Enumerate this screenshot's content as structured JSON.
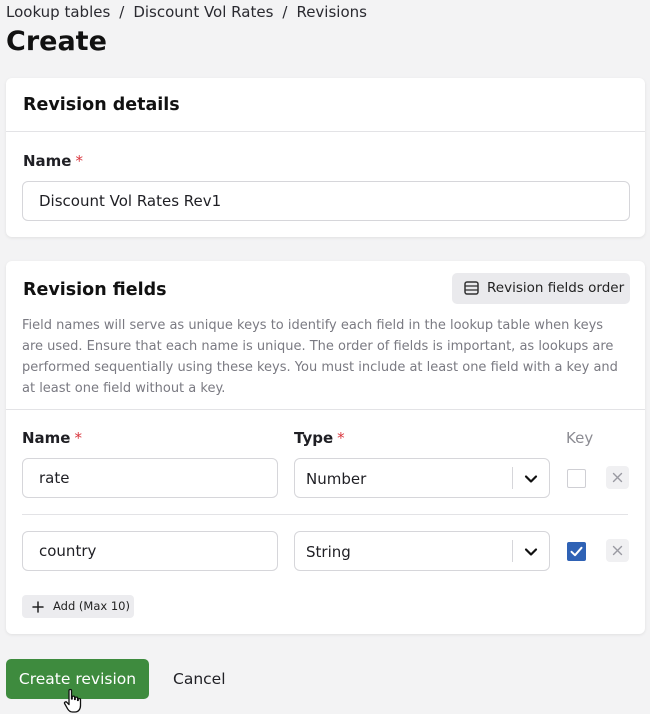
{
  "breadcrumb": [
    "Lookup tables",
    "Discount Vol Rates",
    "Revisions"
  ],
  "page_title": "Create",
  "details": {
    "title": "Revision details",
    "name_label": "Name",
    "required_mark": "*",
    "name_value": "Discount Vol Rates Rev1"
  },
  "fields": {
    "title": "Revision fields",
    "order_button": "Revision fields order",
    "help": "Field names will serve as unique keys to identify each field in the lookup table when keys are used. Ensure that each name is unique. The order of fields is important, as lookups are performed sequentially using these keys. You must include at least one field with a key and at least one field without a key.",
    "columns": {
      "name": "Name",
      "type": "Type",
      "key": "Key",
      "required_mark": "*"
    },
    "rows": [
      {
        "name": "rate",
        "type": "Number",
        "key": false
      },
      {
        "name": "country",
        "type": "String",
        "key": true
      }
    ],
    "add_button": "Add (Max 10)"
  },
  "actions": {
    "create": "Create revision",
    "cancel": "Cancel"
  },
  "colors": {
    "primary": "#3e8b3e",
    "required": "#d9363e",
    "checkbox_checked": "#2f62b5"
  },
  "icons": {
    "order": "list-icon",
    "chevron": "chevron-down-icon",
    "remove": "close-icon",
    "add": "plus-icon",
    "check": "check-icon",
    "cursor": "hand-pointer-icon"
  }
}
